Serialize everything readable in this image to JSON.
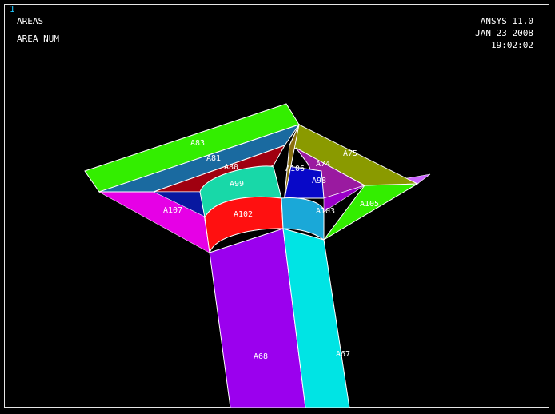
{
  "window": {
    "number": "1"
  },
  "header": {
    "plot_type": "AREAS",
    "numbering": "AREA NUM",
    "software": "ANSYS 11.0",
    "date": "JAN 23 2008",
    "time": "19:02:02"
  },
  "area_labels": {
    "a83": "A83",
    "a81": "A81",
    "a80": "A80",
    "a99": "A99",
    "a106": "A106",
    "a74": "A74",
    "a75": "A75",
    "a98": "A98",
    "a107": "A107",
    "a102": "A102",
    "a103": "A103",
    "a105": "A105",
    "a68": "A68",
    "a67": "A67"
  },
  "colors": {
    "background": "#000000",
    "frame": "#e6e6e6",
    "window_number": "#1ec8ff",
    "column_left": "#9b00ee",
    "column_right": "#00e4e4",
    "plate_top_left": "#33ee00",
    "plate_top_right": "#8a9a00",
    "plate_left": "#e600e6",
    "plate_right": "#33ee00",
    "band_red": "#ff1010",
    "band_teal": "#18d8a8"
  }
}
